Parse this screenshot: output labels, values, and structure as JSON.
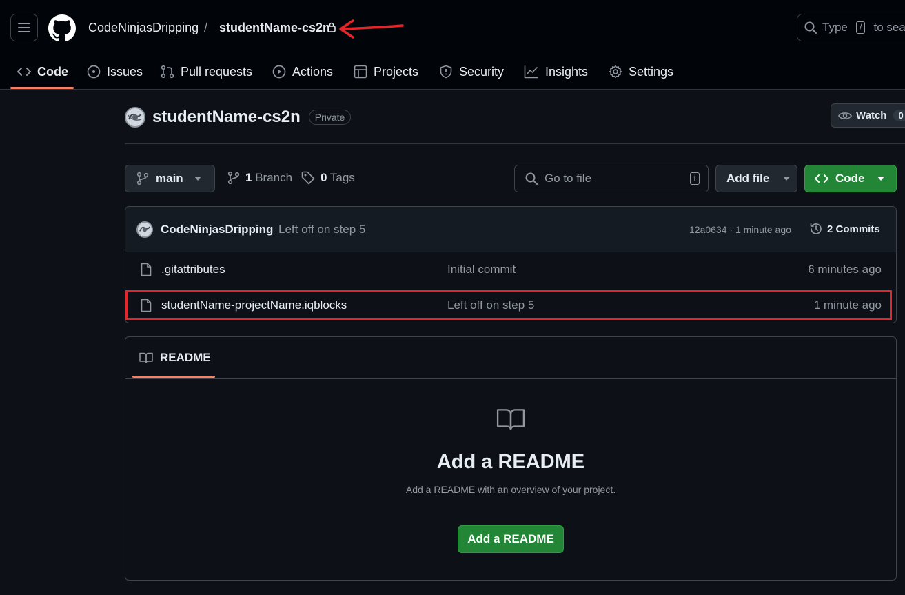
{
  "header": {
    "owner": "CodeNinjasDripping",
    "separator": "/",
    "repo": "studentName-cs2n",
    "search_prefix": "Type",
    "search_key": "/",
    "search_suffix": "to sear"
  },
  "tabs": [
    {
      "label": "Code",
      "icon": "code-icon"
    },
    {
      "label": "Issues",
      "icon": "issue-icon"
    },
    {
      "label": "Pull requests",
      "icon": "pull-request-icon"
    },
    {
      "label": "Actions",
      "icon": "play-icon"
    },
    {
      "label": "Projects",
      "icon": "table-icon"
    },
    {
      "label": "Security",
      "icon": "shield-icon"
    },
    {
      "label": "Insights",
      "icon": "graph-icon"
    },
    {
      "label": "Settings",
      "icon": "gear-icon"
    }
  ],
  "repo": {
    "name": "studentName-cs2n",
    "visibility": "Private",
    "watch_label": "Watch",
    "watch_count": "0"
  },
  "toolbar": {
    "branch": "main",
    "branch_count": "1",
    "branch_label": "Branch",
    "tag_count": "0",
    "tag_label": "Tags",
    "gofile_placeholder": "Go to file",
    "gofile_key": "t",
    "add_file": "Add file",
    "code": "Code"
  },
  "latest_commit": {
    "author": "CodeNinjasDripping",
    "message": "Left off on step 5",
    "hash_time": "12a0634 · 1 minute ago",
    "commits_label": "2 Commits"
  },
  "files": [
    {
      "name": ".gitattributes",
      "commit": "Initial commit",
      "age": "6 minutes ago"
    },
    {
      "name": "studentName-projectName.iqblocks",
      "commit": "Left off on step 5",
      "age": "1 minute ago"
    }
  ],
  "readme": {
    "tab_label": "README",
    "title": "Add a README",
    "subtitle": "Add a README with an overview of your project.",
    "button": "Add a README"
  },
  "colors": {
    "background": "#0d1117",
    "accent_green": "#238636",
    "tab_underline": "#f78166",
    "annotation_red": "#e3262b"
  }
}
